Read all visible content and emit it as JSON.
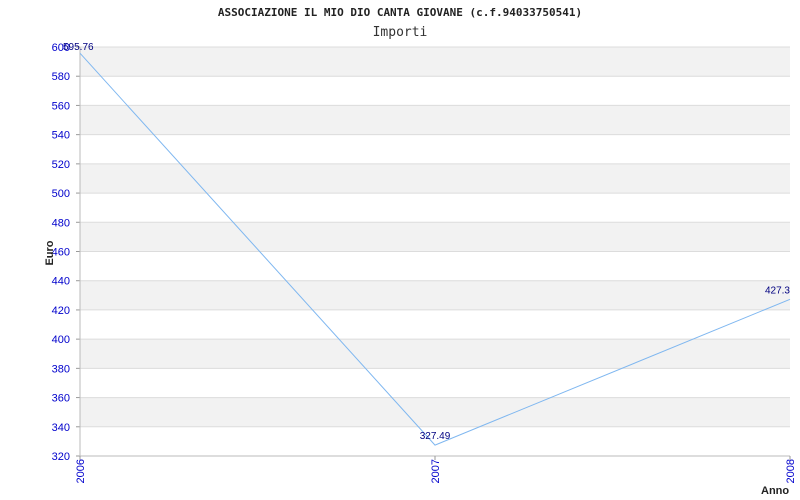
{
  "header": {
    "title": "ASSOCIAZIONE IL MIO DIO CANTA GIOVANE (c.f.94033750541)",
    "subtitle": "Importi"
  },
  "chart_data": {
    "type": "line",
    "title": "ASSOCIAZIONE IL MIO DIO CANTA GIOVANE (c.f.94033750541)",
    "subtitle": "Importi",
    "xlabel": "Anno",
    "ylabel": "Euro",
    "categories": [
      "2006",
      "2007",
      "2008"
    ],
    "series": [
      {
        "values": [
          595.76,
          327.49,
          427.3
        ],
        "labels": [
          "595.76",
          "327.49",
          "427.3"
        ]
      }
    ],
    "ylim": [
      320,
      600
    ],
    "yticks": [
      320,
      340,
      360,
      380,
      400,
      420,
      440,
      460,
      480,
      500,
      520,
      540,
      560,
      580,
      600
    ],
    "grid": true,
    "colors": {
      "line": "#7fb7f0",
      "band": "#f2f2f2",
      "tick_text": "#0000cc",
      "data_label": "#000080"
    }
  }
}
